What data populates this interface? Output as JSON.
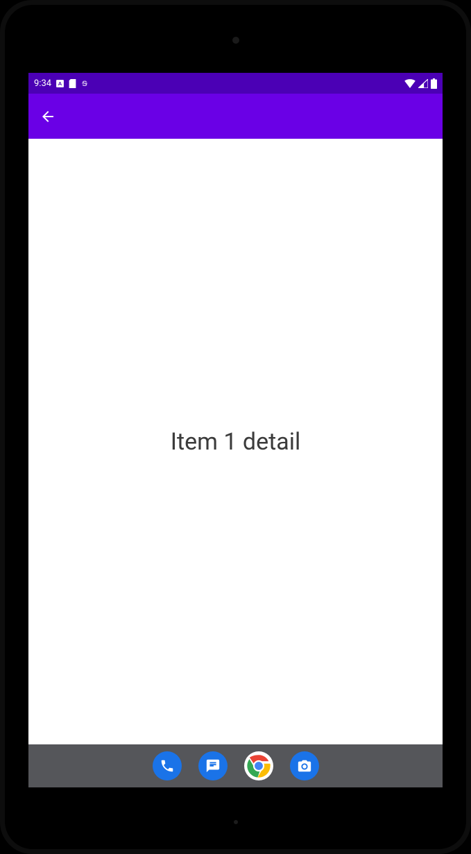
{
  "statusbar": {
    "time": "9:34",
    "icons_left": [
      "letter-a-box-icon",
      "sd-card-icon",
      "strike-s-icon"
    ],
    "icons_right": [
      "wifi-icon",
      "signal-icon",
      "battery-icon"
    ]
  },
  "appbar": {
    "back_icon": "back-arrow-icon"
  },
  "content": {
    "text": "Item 1 detail"
  },
  "navbar": {
    "apps": [
      {
        "name": "phone-app",
        "color": "#1a73e8"
      },
      {
        "name": "messages-app",
        "color": "#1a73e8"
      },
      {
        "name": "chrome-app",
        "color": "#ffffff"
      },
      {
        "name": "camera-app",
        "color": "#1a73e8"
      }
    ]
  },
  "colors": {
    "statusbar": "#4b00b5",
    "appbar": "#6a00e6",
    "navbar": "#55565a"
  }
}
